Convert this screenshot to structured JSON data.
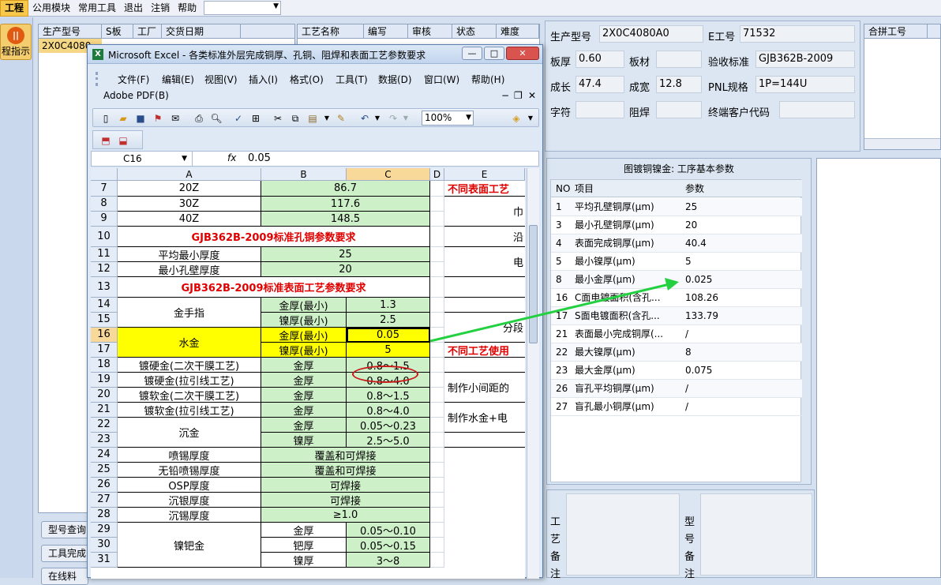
{
  "menu": {
    "items": [
      "工程",
      "公用模块",
      "常用工具",
      "退出",
      "注销",
      "帮助"
    ]
  },
  "leftnav": {
    "button": "程指示",
    "icon": "||",
    "buttons": [
      "型号查询",
      "工具完成",
      "在线料"
    ]
  },
  "left_grid": {
    "headers": [
      "生产型号",
      "S板",
      "工厂",
      "交货日期"
    ],
    "rows": [
      [
        "2X0C4080",
        "",
        "",
        ""
      ]
    ]
  },
  "mid_grid": {
    "headers": [
      "工艺名称",
      "编写",
      "审核",
      "状态",
      "难度"
    ]
  },
  "info": {
    "label_model": "生产型号",
    "model": "2X0C4080A0",
    "label_e": "E工号",
    "e_no": "71532",
    "label_thick": "板厚",
    "thick": "0.60",
    "label_mat": "板材",
    "mat": "",
    "label_std": "验收标准",
    "std": "GJB362B-2009",
    "label_len": "成长",
    "len": "47.4",
    "label_wid": "成宽",
    "wid": "12.8",
    "label_pnl": "PNL规格",
    "pnl": "1P=144U",
    "label_char": "字符",
    "char": "",
    "label_sm": "阻焊",
    "sm": "",
    "label_cust": "终端客户代码",
    "cust": ""
  },
  "merge_grid": {
    "header": "合拼工号"
  },
  "params": {
    "title": "图镀铜镍金: 工序基本参数",
    "col_no": "NO",
    "col_item": "项目",
    "col_val": "参数",
    "rows": [
      {
        "no": "1",
        "item": "平均孔壁铜厚(μm)",
        "val": "25"
      },
      {
        "no": "3",
        "item": "最小孔壁铜厚(μm)",
        "val": "20"
      },
      {
        "no": "4",
        "item": "表面完成铜厚(μm)",
        "val": "40.4"
      },
      {
        "no": "5",
        "item": "最小镍厚(μm)",
        "val": "5"
      },
      {
        "no": "8",
        "item": "最小金厚(μm)",
        "val": "0.025"
      },
      {
        "no": "16",
        "item": "C面电镀面积(含孔...",
        "val": "108.26"
      },
      {
        "no": "17",
        "item": "S面电镀面积(含孔...",
        "val": "133.79"
      },
      {
        "no": "21",
        "item": "表面最小完成铜厚(...",
        "val": "/"
      },
      {
        "no": "22",
        "item": "最大镍厚(μm)",
        "val": "8"
      },
      {
        "no": "23",
        "item": "最大金厚(μm)",
        "val": "0.075"
      },
      {
        "no": "26",
        "item": "盲孔平均铜厚(μm)",
        "val": "/"
      },
      {
        "no": "27",
        "item": "盲孔最小铜厚(μm)",
        "val": "/"
      }
    ]
  },
  "notes": {
    "process": "工艺备注",
    "model": "型号备注"
  },
  "excel": {
    "title": "Microsoft Excel - 各类标准外层完成铜厚、孔铜、阻焊和表面工艺参数要求",
    "menu": [
      "文件(F)",
      "编辑(E)",
      "视图(V)",
      "插入(I)",
      "格式(O)",
      "工具(T)",
      "数据(D)",
      "窗口(W)",
      "帮助(H)"
    ],
    "menu2": "Adobe PDF(B)",
    "zoom": "100%",
    "namebox": "C16",
    "fx": "fx",
    "formula": "0.05",
    "cols": [
      "A",
      "B",
      "C",
      "D",
      "E"
    ],
    "rows": [
      "7",
      "8",
      "9",
      "10",
      "11",
      "12",
      "13",
      "14",
      "15",
      "16",
      "17",
      "18",
      "19",
      "20",
      "21",
      "22",
      "23",
      "24",
      "25",
      "26",
      "27",
      "28",
      "29",
      "30",
      "31"
    ],
    "cells": {
      "a7": "20Z",
      "b7": "86.7",
      "a8": "30Z",
      "b8": "117.6",
      "a9": "40Z",
      "b9": "148.5",
      "h10": "GJB362B-2009标准孔铜参数要求",
      "a11": "平均最小厚度",
      "b11": "25",
      "a12": "最小孔壁厚度",
      "b12": "20",
      "h13": "GJB362B-2009标准表面工艺参数要求",
      "a14": "金手指",
      "b14": "金厚(最小)",
      "c14": "1.3",
      "b15": "镍厚(最小)",
      "c15": "2.5",
      "a16": "水金",
      "b16": "金厚(最小)",
      "c16": "0.05",
      "b17": "镍厚(最小)",
      "c17": "5",
      "a18": "镀硬金(二次干膜工艺)",
      "b18": "金厚",
      "c18": "0.8～1.5",
      "a19": "镀硬金(拉引线工艺)",
      "b19": "金厚",
      "c19": "0.8～4.0",
      "a20": "镀软金(二次干膜工艺)",
      "b20": "金厚",
      "c20": "0.8～1.5",
      "a21": "镀软金(拉引线工艺)",
      "b21": "金厚",
      "c21": "0.8～4.0",
      "a22": "沉金",
      "b22": "金厚",
      "c22": "0.05～0.23",
      "b23": "镍厚",
      "c23": "2.5～5.0",
      "a24": "喷锡厚度",
      "b24": "覆盖和可焊接",
      "a25": "无铅喷锡厚度",
      "b25": "覆盖和可焊接",
      "a26": "OSP厚度",
      "b26": "可焊接",
      "a27": "沉银厚度",
      "b27": "可焊接",
      "a28": "沉锡厚度",
      "b28": "≥1.0",
      "a29": "镍钯金",
      "b29": "金厚",
      "c29": "0.05～0.10",
      "b30": "钯厚",
      "c30": "0.05～0.15",
      "b31": "镍厚",
      "c31": "3～8",
      "e7": "不同表面工艺",
      "e8": "巾",
      "e10": "沿",
      "e11": "电",
      "e15": "分段",
      "e17": "不同工艺使用",
      "e19": "制作小间距的",
      "e21": "制作水金+电"
    }
  }
}
